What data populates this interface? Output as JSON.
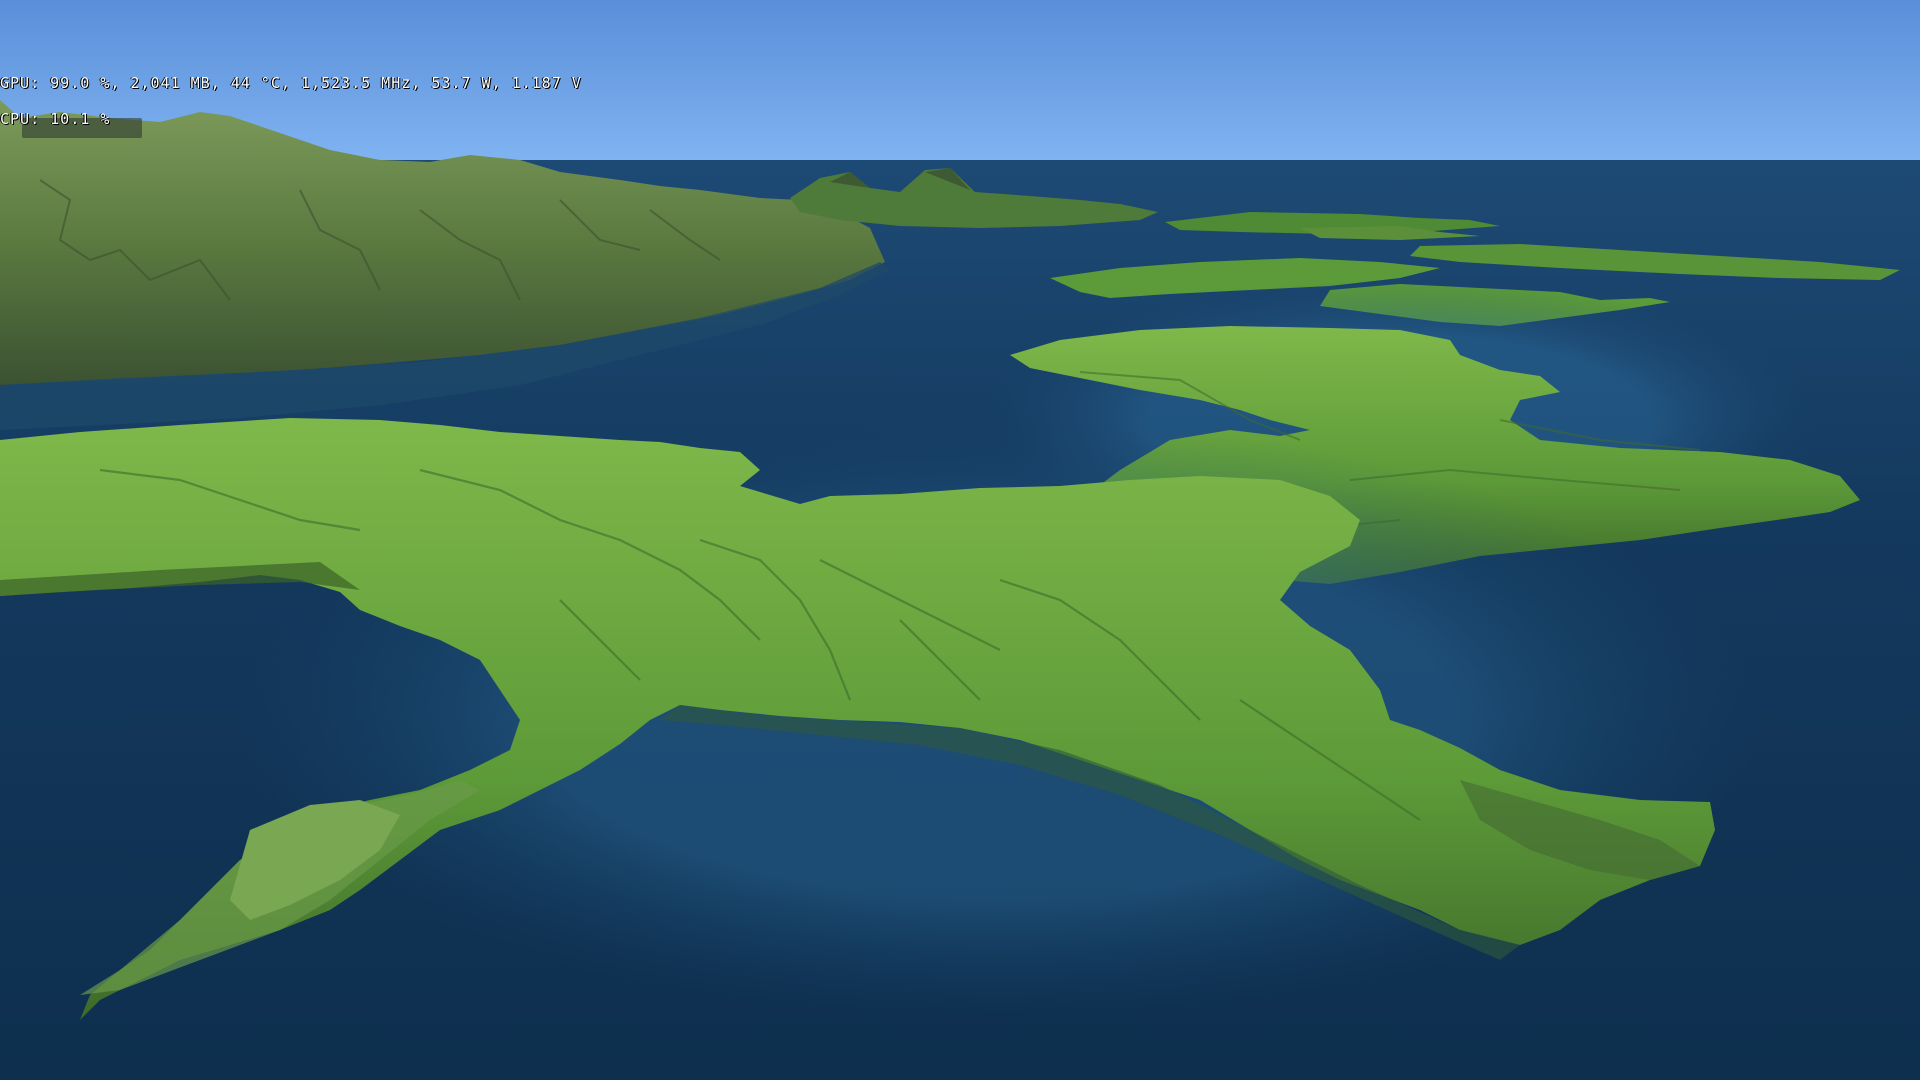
{
  "hud": {
    "gpu_line": "GPU: 99.0 %, 2,041 MB, 44 °C, 1,523.5 MHz, 53.7 W, 1.187 V",
    "cpu_line": "CPU: 10.1 %"
  },
  "scene": {
    "colors": {
      "sky_top": "#5a8ed8",
      "sky_horizon": "#7fb2f0",
      "ocean_deep": "#0f3354",
      "ocean_mid": "#1a4a72",
      "shallows": "#2a6a9a",
      "grass": "#5a9a3a",
      "grass_light": "#7ab548",
      "rock": "#6f7a5a",
      "shadow": "#2f4a28"
    }
  }
}
